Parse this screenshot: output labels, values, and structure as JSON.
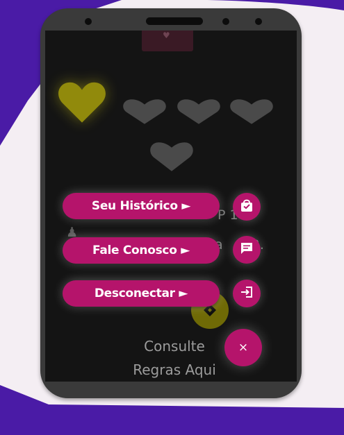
{
  "colors": {
    "page_background": "#f4eef3",
    "purple_shape": "#4a1ba6",
    "phone_frame": "#3a3a3a",
    "screen": "#141414",
    "accent_magenta": "#b5146b",
    "heart_active": "#918a0c",
    "heart_inactive": "#4a4a4a"
  },
  "lives": {
    "active": 1,
    "total": 5,
    "active_icon": "heart-icon",
    "inactive_icon": "heart-icon"
  },
  "background_text": {
    "line1_fragment": "P 1",
    "line2_fragment": "a   el 2."
  },
  "menu": {
    "items": [
      {
        "label": "Seu Histórico ►",
        "icon": "shopping-bag-icon"
      },
      {
        "label": "Fale Conosco ►",
        "icon": "chat-message-icon"
      },
      {
        "label": "Desconectar ►",
        "icon": "logout-icon"
      }
    ],
    "close_label": "×",
    "close_icon": "close-icon"
  },
  "footer": {
    "line1": "Consulte",
    "line2": "Regras Aqui"
  }
}
